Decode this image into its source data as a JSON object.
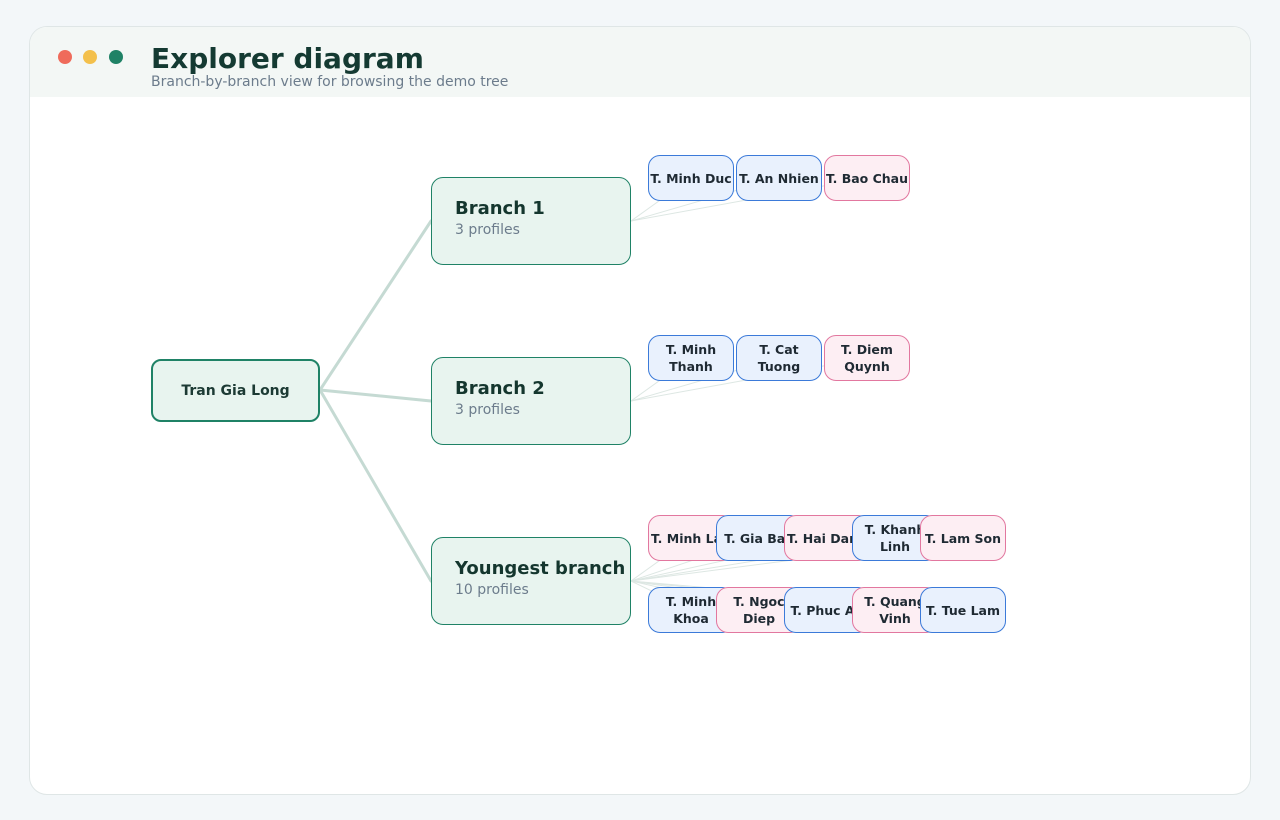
{
  "window": {
    "title": "Explorer diagram",
    "subtitle": "Branch-by-branch view for browsing the demo tree"
  },
  "colors": {
    "accent": "#1f8266",
    "male_border": "#3b7ad9",
    "female_border": "#e2779f",
    "link": "#c5dad3"
  },
  "tree": {
    "root": {
      "name": "Tran Gia Long"
    },
    "branches": [
      {
        "name": "Branch 1",
        "count_label": "3 profiles",
        "children": [
          {
            "name": "T. Minh Duc",
            "gender": "male"
          },
          {
            "name": "T. An Nhien",
            "gender": "male"
          },
          {
            "name": "T. Bao Chau",
            "gender": "female"
          }
        ]
      },
      {
        "name": "Branch 2",
        "count_label": "3 profiles",
        "children": [
          {
            "name": "T. Minh Thanh",
            "gender": "male"
          },
          {
            "name": "T. Cat Tuong",
            "gender": "male"
          },
          {
            "name": "T. Diem Quynh",
            "gender": "female"
          }
        ]
      },
      {
        "name": "Youngest branch",
        "count_label": "10 profiles",
        "children": [
          {
            "name": "T. Minh Lan",
            "gender": "female"
          },
          {
            "name": "T. Gia Bao",
            "gender": "male"
          },
          {
            "name": "T. Hai Dang",
            "gender": "female"
          },
          {
            "name": "T. Khanh Linh",
            "gender": "male"
          },
          {
            "name": "T. Lam Son",
            "gender": "female"
          },
          {
            "name": "T. Minh Khoa",
            "gender": "male"
          },
          {
            "name": "T. Ngoc Diep",
            "gender": "female"
          },
          {
            "name": "T. Phuc An",
            "gender": "male"
          },
          {
            "name": "T. Quang Vinh",
            "gender": "female"
          },
          {
            "name": "T. Tue Lam",
            "gender": "male"
          }
        ]
      }
    ]
  }
}
